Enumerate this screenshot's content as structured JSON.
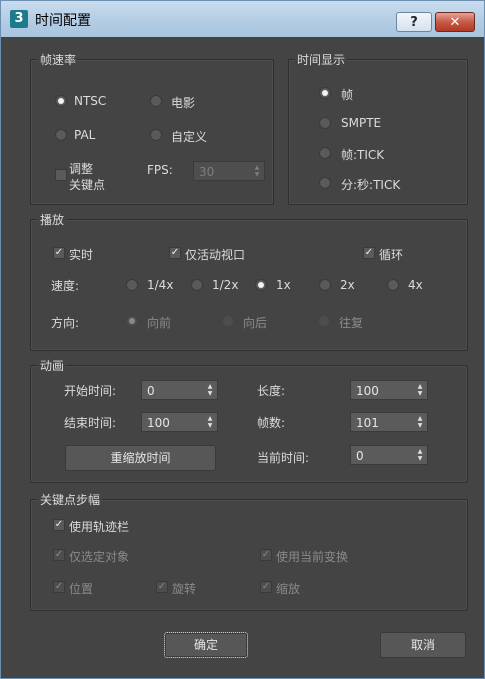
{
  "window": {
    "title": "时间配置",
    "help": "?",
    "close": "✕"
  },
  "frame_rate": {
    "title": "帧速率",
    "ntsc": "NTSC",
    "film": "电影",
    "pal": "PAL",
    "custom": "自定义",
    "adjust_keys_line1": "调整",
    "adjust_keys_line2": "关键点",
    "fps_label": "FPS:",
    "fps_value": "30"
  },
  "time_display": {
    "title": "时间显示",
    "frames": "帧",
    "smpte": "SMPTE",
    "frame_tick": "帧:TICK",
    "mm_ss_tick": "分:秒:TICK"
  },
  "playback": {
    "title": "播放",
    "realtime": "实时",
    "active_viewport": "仅活动视口",
    "loop": "循环",
    "speed_label": "速度:",
    "speeds": [
      "1/4x",
      "1/2x",
      "1x",
      "2x",
      "4x"
    ],
    "speed_selected": "1x",
    "direction_label": "方向:",
    "forward": "向前",
    "reverse": "向后",
    "ping_pong": "往复"
  },
  "animation": {
    "title": "动画",
    "start_label": "开始时间:",
    "start_value": "0",
    "end_label": "结束时间:",
    "end_value": "100",
    "length_label": "长度:",
    "length_value": "100",
    "frames_label": "帧数:",
    "frames_value": "101",
    "rescale_button": "重缩放时间",
    "current_label": "当前时间:",
    "current_value": "0"
  },
  "key_steps": {
    "title": "关键点步幅",
    "use_trackbar": "使用轨迹栏",
    "selected_only": "仅选定对象",
    "use_transform": "使用当前变换",
    "position": "位置",
    "rotation": "旋转",
    "scale": "缩放"
  },
  "buttons": {
    "ok": "确定",
    "cancel": "取消"
  }
}
